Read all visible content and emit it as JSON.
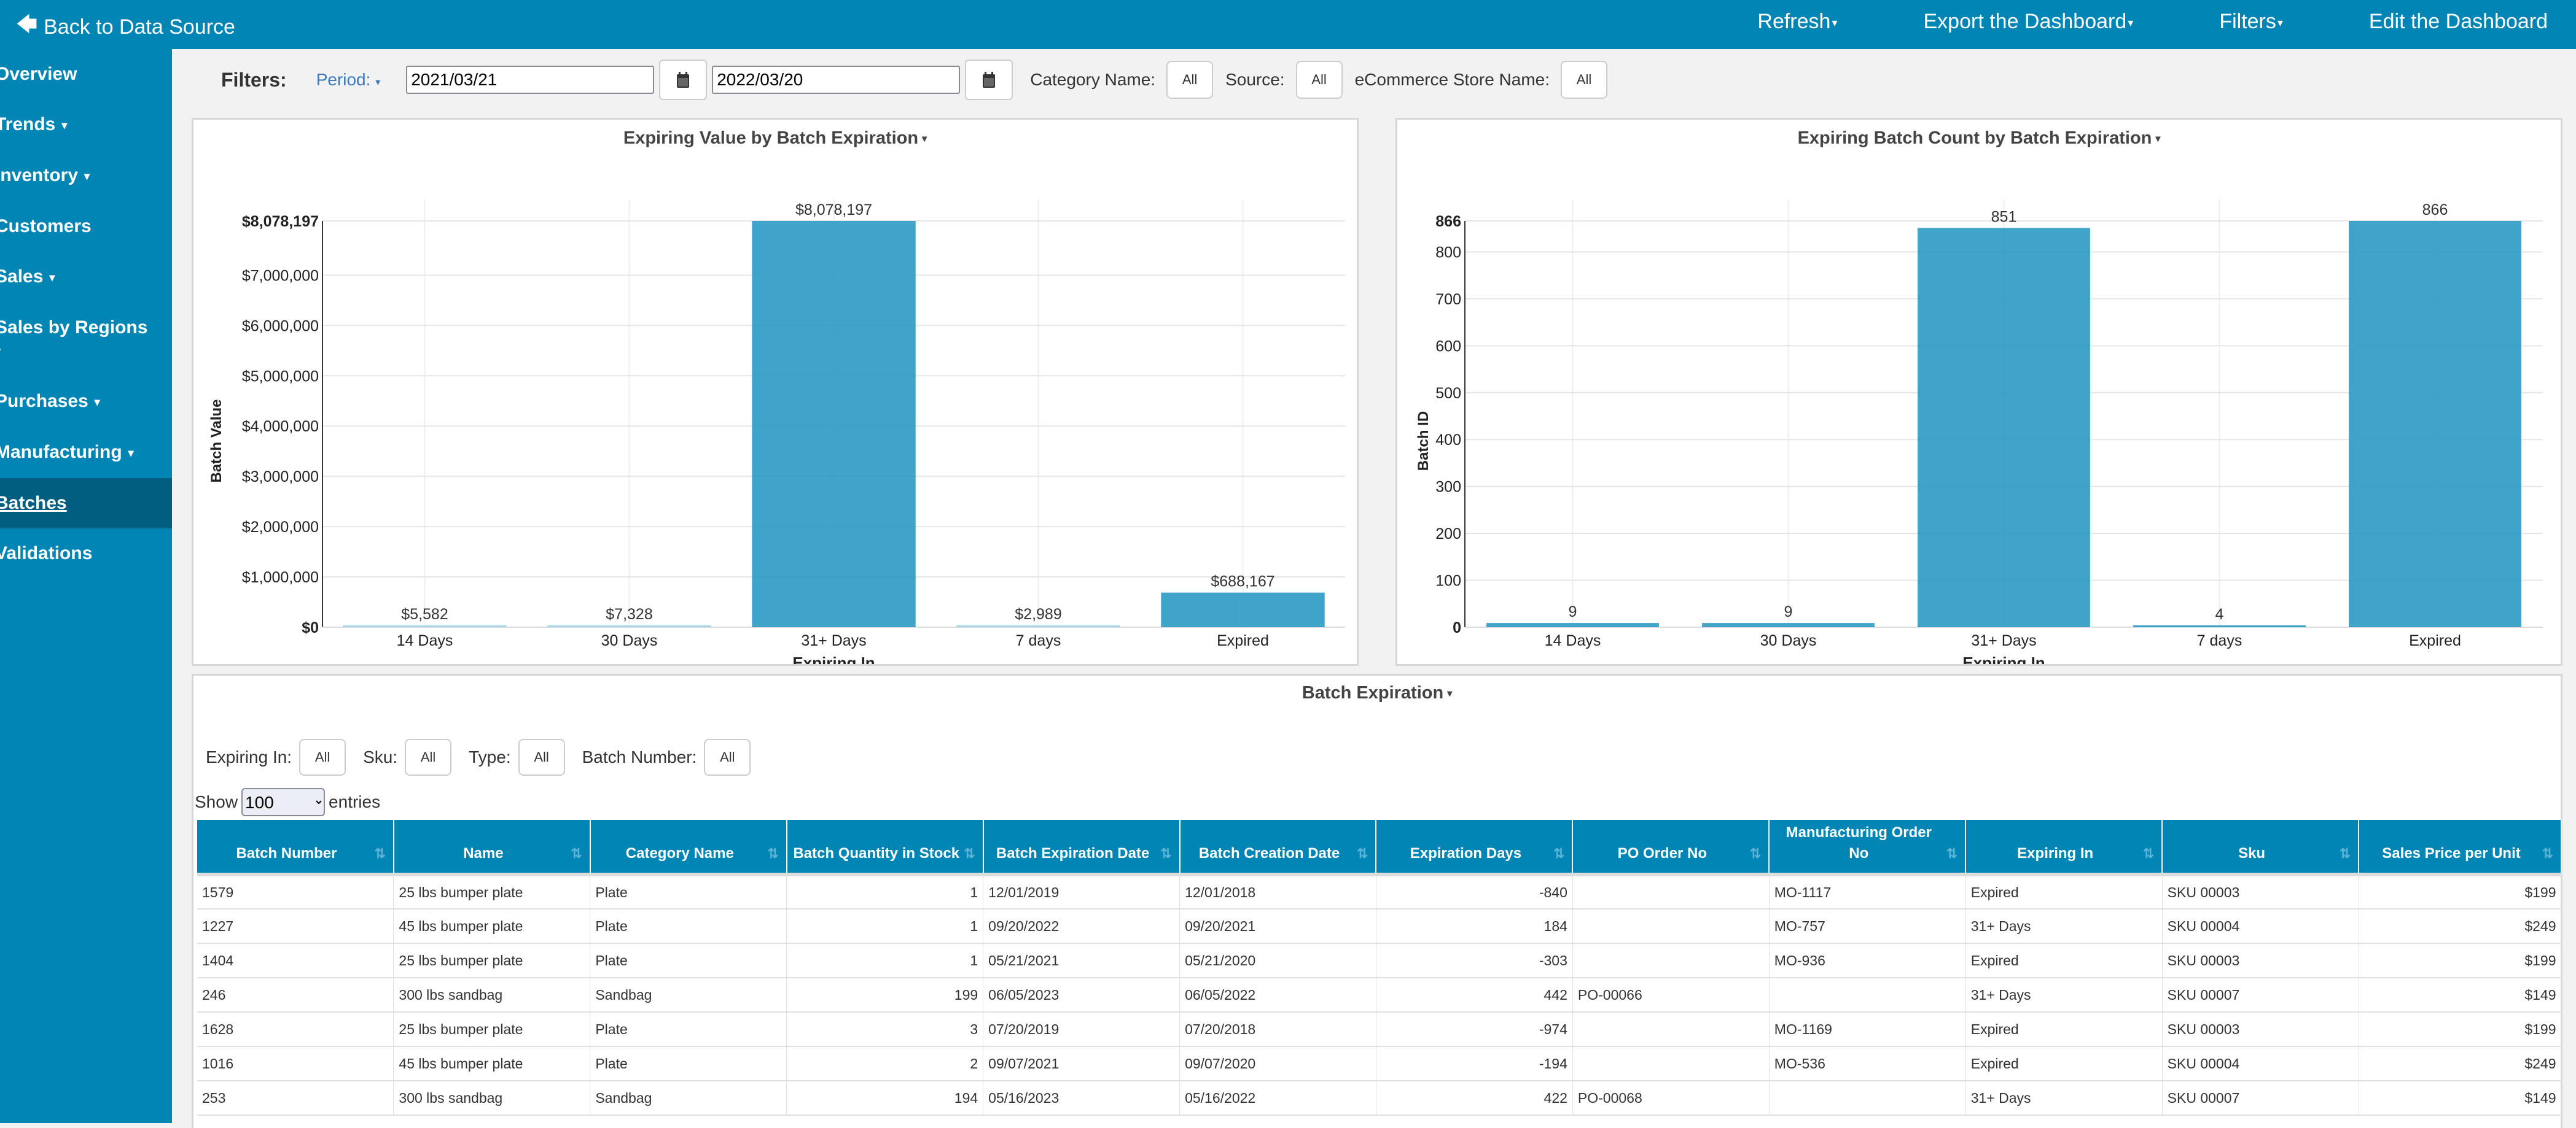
{
  "topbar": {
    "back_label": "Back to Data Source",
    "back_icon": "arrow-left-icon",
    "menu": [
      {
        "label": "Refresh",
        "has_caret": true
      },
      {
        "label": "Export the Dashboard",
        "has_caret": true
      },
      {
        "label": "Filters",
        "has_caret": true
      },
      {
        "label": "Edit the Dashboard",
        "has_caret": false
      }
    ]
  },
  "sidebar": {
    "items": [
      {
        "label": "Overview",
        "caret": false
      },
      {
        "label": "Trends",
        "caret": true
      },
      {
        "label": "Inventory",
        "caret": true
      },
      {
        "label": "Customers",
        "caret": false
      },
      {
        "label": "Sales",
        "caret": true
      },
      {
        "label": "Sales by Regions",
        "caret": true
      },
      {
        "label": "Purchases",
        "caret": true
      },
      {
        "label": "Manufacturing",
        "caret": true
      },
      {
        "label": "Batches",
        "caret": false,
        "active": true
      },
      {
        "label": "Validations",
        "caret": false
      }
    ]
  },
  "filters": {
    "title": "Filters:",
    "period_label": "Period:",
    "start_date": "2021/03/21",
    "end_date": "2022/03/20",
    "category_label": "Category Name:",
    "category_value": "All",
    "source_label": "Source:",
    "source_value": "All",
    "store_label": "eCommerce Store Name:",
    "store_value": "All"
  },
  "colors": {
    "brand": "#0085b5",
    "sidebar_active": "#005e80",
    "bar": "#2596c3",
    "period_link": "#3a7ab8"
  },
  "chart_data": [
    {
      "type": "bar",
      "title": "Expiring Value by Batch Expiration",
      "xlabel": "Expiring In",
      "ylabel": "Batch Value",
      "categories": [
        "14 Days",
        "30 Days",
        "31+ Days",
        "7 days",
        "Expired"
      ],
      "values": [
        5582,
        7328,
        8078197,
        2989,
        688167
      ],
      "value_labels": [
        "$5,582",
        "$7,328",
        "$8,078,197",
        "$2,989",
        "$688,167"
      ],
      "ylim": [
        0,
        8078197
      ],
      "yticks": [
        0,
        1000000,
        2000000,
        3000000,
        4000000,
        5000000,
        6000000,
        7000000,
        8078197
      ],
      "ytick_labels": [
        "$0",
        "$1,000,000",
        "$2,000,000",
        "$3,000,000",
        "$4,000,000",
        "$5,000,000",
        "$6,000,000",
        "$7,000,000",
        "$8,078,197"
      ],
      "grid": true
    },
    {
      "type": "bar",
      "title": "Expiring Batch Count by Batch Expiration",
      "xlabel": "Expiring In",
      "ylabel": "Batch ID",
      "categories": [
        "14 Days",
        "30 Days",
        "31+ Days",
        "7 days",
        "Expired"
      ],
      "values": [
        9,
        9,
        851,
        4,
        866
      ],
      "value_labels": [
        "9",
        "9",
        "851",
        "4",
        "866"
      ],
      "ylim": [
        0,
        866
      ],
      "yticks": [
        0,
        100,
        200,
        300,
        400,
        500,
        600,
        700,
        800,
        866
      ],
      "ytick_labels": [
        "0",
        "100",
        "200",
        "300",
        "400",
        "500",
        "600",
        "700",
        "800",
        "866"
      ],
      "grid": true
    }
  ],
  "table_section": {
    "title": "Batch Expiration",
    "filters": [
      {
        "label": "Expiring In:",
        "value": "All"
      },
      {
        "label": "Sku:",
        "value": "All"
      },
      {
        "label": "Type:",
        "value": "All"
      },
      {
        "label": "Batch Number:",
        "value": "All"
      }
    ],
    "show_label": "Show",
    "entries_value": "100",
    "entries_label": "entries",
    "columns": [
      "Batch Number",
      "Name",
      "Category Name",
      "Batch Quantity in Stock",
      "Batch Expiration Date",
      "Batch Creation Date",
      "Expiration Days",
      "PO Order No",
      "Manufacturing Order No",
      "Expiring In",
      "Sku",
      "Sales Price per Unit"
    ],
    "rows": [
      [
        "1579",
        "25 lbs bumper plate",
        "Plate",
        "1",
        "12/01/2019",
        "12/01/2018",
        "-840",
        "",
        "MO-1117",
        "Expired",
        "SKU 00003",
        "$199"
      ],
      [
        "1227",
        "45 lbs bumper plate",
        "Plate",
        "1",
        "09/20/2022",
        "09/20/2021",
        "184",
        "",
        "MO-757",
        "31+ Days",
        "SKU 00004",
        "$249"
      ],
      [
        "1404",
        "25 lbs bumper plate",
        "Plate",
        "1",
        "05/21/2021",
        "05/21/2020",
        "-303",
        "",
        "MO-936",
        "Expired",
        "SKU 00003",
        "$199"
      ],
      [
        "246",
        "300 lbs sandbag",
        "Sandbag",
        "199",
        "06/05/2023",
        "06/05/2022",
        "442",
        "PO-00066",
        "",
        "31+ Days",
        "SKU 00007",
        "$149"
      ],
      [
        "1628",
        "25 lbs bumper plate",
        "Plate",
        "3",
        "07/20/2019",
        "07/20/2018",
        "-974",
        "",
        "MO-1169",
        "Expired",
        "SKU 00003",
        "$199"
      ],
      [
        "1016",
        "45 lbs bumper plate",
        "Plate",
        "2",
        "09/07/2021",
        "09/07/2020",
        "-194",
        "",
        "MO-536",
        "Expired",
        "SKU 00004",
        "$249"
      ],
      [
        "253",
        "300 lbs sandbag",
        "Sandbag",
        "194",
        "05/16/2023",
        "05/16/2022",
        "422",
        "PO-00068",
        "",
        "31+ Days",
        "SKU 00007",
        "$149"
      ]
    ]
  }
}
